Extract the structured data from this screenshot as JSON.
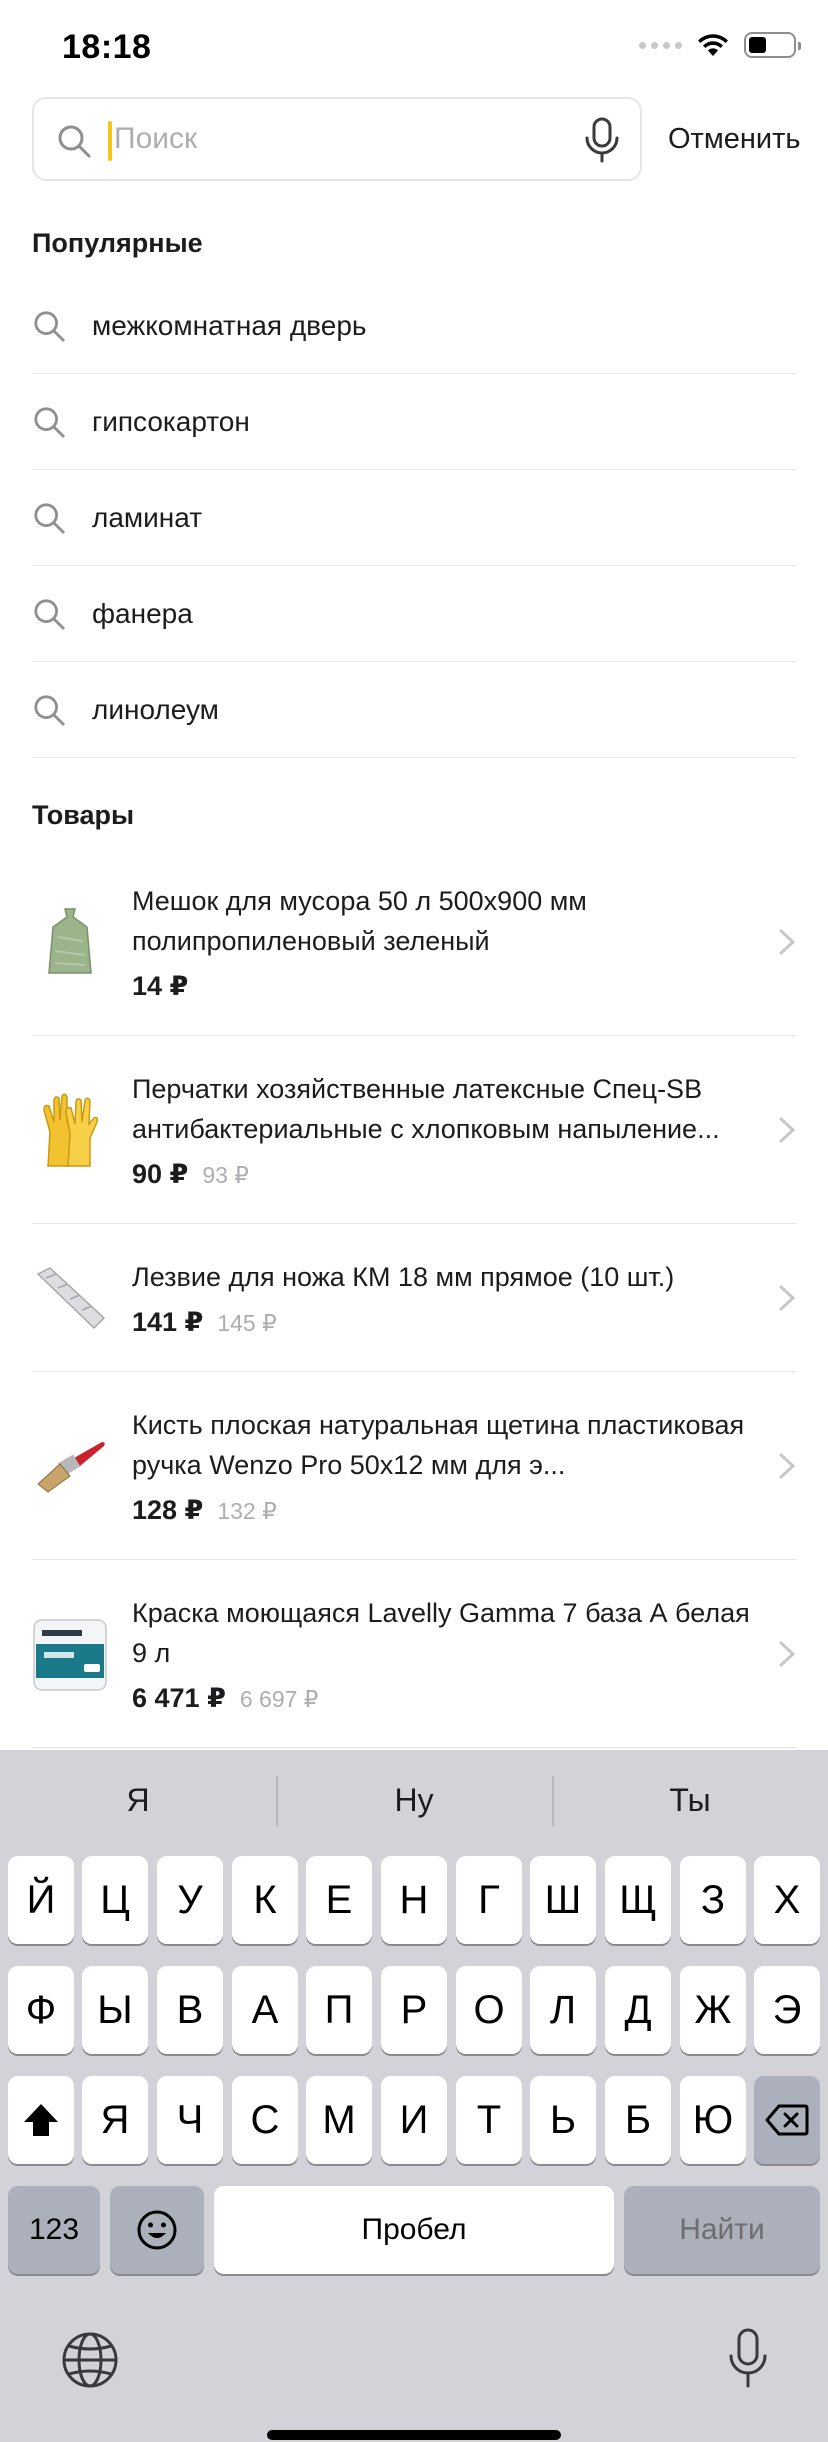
{
  "status_bar": {
    "time": "18:18"
  },
  "search": {
    "placeholder": "Поиск",
    "value": "",
    "cancel_label": "Отменить"
  },
  "popular": {
    "title": "Популярные",
    "items": [
      "межкомнатная дверь",
      "гипсокартон",
      "ламинат",
      "фанера",
      "линолеум"
    ]
  },
  "products": {
    "title": "Товары",
    "items": [
      {
        "name": "Мешок для мусора 50 л 500x900 мм полипропиленовый зеленый",
        "price": "14 ₽",
        "old_price": ""
      },
      {
        "name": "Перчатки хозяйственные латексные Спец-SB антибактериальные с хлопковым напыление...",
        "price": "90 ₽",
        "old_price": "93 ₽"
      },
      {
        "name": "Лезвие для ножа КМ 18 мм прямое (10 шт.)",
        "price": "141 ₽",
        "old_price": "145 ₽"
      },
      {
        "name": "Кисть плоская натуральная щетина пластиковая ручка Wenzo Pro 50x12 мм для э...",
        "price": "128 ₽",
        "old_price": "132 ₽"
      },
      {
        "name": "Краска моющаяся Lavelly Gamma 7 база А белая 9 л",
        "price": "6 471 ₽",
        "old_price": "6 697 ₽"
      }
    ]
  },
  "keyboard": {
    "suggestions": [
      "Я",
      "Ну",
      "Ты"
    ],
    "row1": [
      "Й",
      "Ц",
      "У",
      "К",
      "Е",
      "Н",
      "Г",
      "Ш",
      "Щ",
      "З",
      "Х"
    ],
    "row2": [
      "Ф",
      "Ы",
      "В",
      "А",
      "П",
      "Р",
      "О",
      "Л",
      "Д",
      "Ж",
      "Э"
    ],
    "row3": [
      "Я",
      "Ч",
      "С",
      "М",
      "И",
      "Т",
      "Ь",
      "Б",
      "Ю"
    ],
    "numbers_label": "123",
    "space_label": "Пробел",
    "return_label": "Найти"
  },
  "colors": {
    "accent_cursor": "#f5c518",
    "keyboard_bg": "#d1d3d9",
    "dark_key": "#abb0ba",
    "divider": "#e5e5ea",
    "muted_text": "#aeaeb2"
  },
  "icons": {
    "search": "search-icon",
    "mic": "microphone-icon",
    "chevron": "chevron-right-icon",
    "shift": "shift-icon",
    "delete": "backspace-icon",
    "emoji": "emoji-icon",
    "globe": "globe-icon",
    "dictation": "dictation-icon"
  }
}
